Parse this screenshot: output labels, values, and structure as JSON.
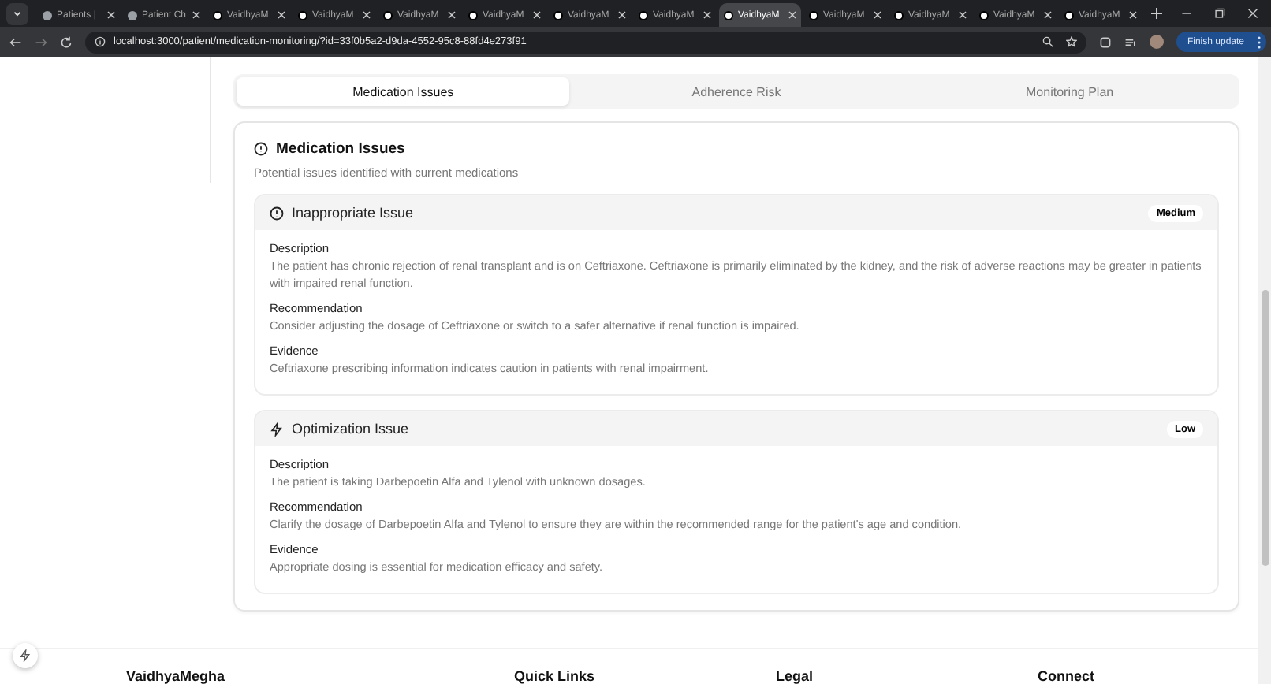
{
  "browser": {
    "tabs": [
      {
        "label": "Patients |",
        "selected": false,
        "kind": "globe"
      },
      {
        "label": "Patient Ch",
        "selected": false,
        "kind": "globe"
      },
      {
        "label": "VaidhyaM",
        "selected": false,
        "kind": "app"
      },
      {
        "label": "VaidhyaM",
        "selected": false,
        "kind": "app"
      },
      {
        "label": "VaidhyaM",
        "selected": false,
        "kind": "app"
      },
      {
        "label": "VaidhyaM",
        "selected": false,
        "kind": "app"
      },
      {
        "label": "VaidhyaM",
        "selected": false,
        "kind": "app"
      },
      {
        "label": "VaidhyaM",
        "selected": false,
        "kind": "app"
      },
      {
        "label": "VaidhyaM",
        "selected": true,
        "kind": "app"
      },
      {
        "label": "VaidhyaM",
        "selected": false,
        "kind": "app"
      },
      {
        "label": "VaidhyaM",
        "selected": false,
        "kind": "app"
      },
      {
        "label": "VaidhyaM",
        "selected": false,
        "kind": "app"
      },
      {
        "label": "VaidhyaM",
        "selected": false,
        "kind": "app"
      }
    ],
    "url": "localhost:3000/patient/medication-monitoring/?id=33f0b5a2-d9da-4552-95c8-88fd4e273f91",
    "update_button": "Finish update"
  },
  "tabs": [
    {
      "label": "Medication Issues",
      "selected": true
    },
    {
      "label": "Adherence Risk",
      "selected": false
    },
    {
      "label": "Monitoring Plan",
      "selected": false
    }
  ],
  "card": {
    "title": "Medication Issues",
    "subtitle": "Potential issues identified with current medications",
    "issues": [
      {
        "kind": "alert",
        "title": "Inappropriate Issue",
        "severity": "Medium",
        "sections": [
          {
            "heading": "Description",
            "text": "The patient has chronic rejection of renal transplant and is on Ceftriaxone. Ceftriaxone is primarily eliminated by the kidney, and the risk of adverse reactions may be greater in patients with impaired renal function."
          },
          {
            "heading": "Recommendation",
            "text": "Consider adjusting the dosage of Ceftriaxone or switch to a safer alternative if renal function is impaired."
          },
          {
            "heading": "Evidence",
            "text": "Ceftriaxone prescribing information indicates caution in patients with renal impairment."
          }
        ]
      },
      {
        "kind": "bolt",
        "title": "Optimization Issue",
        "severity": "Low",
        "sections": [
          {
            "heading": "Description",
            "text": "The patient is taking Darbepoetin Alfa and Tylenol with unknown dosages."
          },
          {
            "heading": "Recommendation",
            "text": "Clarify the dosage of Darbepoetin Alfa and Tylenol to ensure they are within the recommended range for the patient's age and condition."
          },
          {
            "heading": "Evidence",
            "text": "Appropriate dosing is essential for medication efficacy and safety."
          }
        ]
      }
    ]
  },
  "footer": {
    "headings": [
      "VaidhyaMegha",
      "Quick Links",
      "Legal",
      "Connect"
    ]
  }
}
